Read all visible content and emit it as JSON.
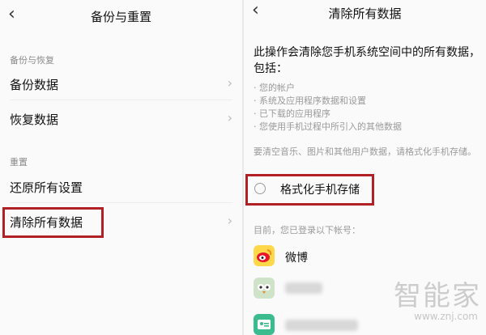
{
  "left": {
    "title": "备份与重置",
    "section1": "备份与恢复",
    "items1": [
      {
        "label": "备份数据"
      },
      {
        "label": "恢复数据"
      }
    ],
    "section2": "重置",
    "items2": [
      {
        "label": "还原所有设置"
      },
      {
        "label": "清除所有数据"
      }
    ]
  },
  "right": {
    "title": "清除所有数据",
    "intro": "此操作会清除您手机系统空间中的所有数据，包括：",
    "bullets": [
      "· 您的帐户",
      "· 系统及应用程序数据和设置",
      "· 已下载的应用程序",
      "· 您使用手机过程中所引入的其他数据"
    ],
    "note": "要清空音乐、图片和其他用户数据，请格式化手机存储。",
    "format_label": "格式化手机存储",
    "accounts_header": "目前，您已登录以下帐号：",
    "accounts": [
      {
        "name": "微博",
        "icon": "weibo-icon"
      },
      {
        "name": "",
        "icon": "owl-app-icon"
      },
      {
        "name": "",
        "icon": "card-app-icon"
      }
    ]
  },
  "watermark": {
    "text": "智能家",
    "url": "www.znj.com"
  },
  "colors": {
    "highlight": "#b02025",
    "weibo": "#ffd84a"
  }
}
